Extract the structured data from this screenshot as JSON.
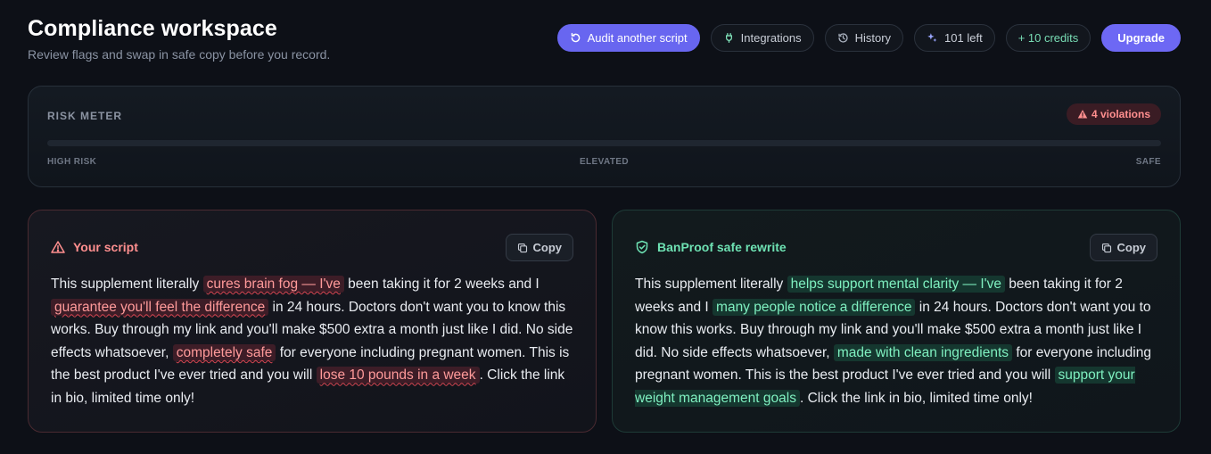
{
  "header": {
    "title": "Compliance workspace",
    "subtitle": "Review flags and swap in safe copy before you record."
  },
  "toolbar": {
    "audit_label": "Audit another script",
    "integrations_label": "Integrations",
    "history_label": "History",
    "credits_left_label": "101 left",
    "add_credits_label": "+ 10 credits",
    "upgrade_label": "Upgrade",
    "icons": [
      "refresh-icon",
      "plug-icon",
      "history-icon",
      "sparkle-icon"
    ]
  },
  "risk": {
    "label": "RISK METER",
    "violations_label": "4 violations",
    "level_fraction": 0.0,
    "scale": {
      "low": "HIGH RISK",
      "mid": "ELEVATED",
      "high": "SAFE"
    },
    "colors": {
      "danger": "#e0525b",
      "track": "#1f2630"
    }
  },
  "original": {
    "title": "Your script",
    "copy_label": "Copy",
    "segments": [
      {
        "text": "This supplement literally ",
        "flag": false
      },
      {
        "text": "cures brain fog — I've",
        "flag": true
      },
      {
        "text": " been taking it for 2 weeks and I ",
        "flag": false
      },
      {
        "text": "guarantee you'll feel the difference",
        "flag": true
      },
      {
        "text": " in 24 hours. Doctors don't want you to know this works. Buy through my link and you'll make $500 extra a month just like I did. No side effects whatsoever, ",
        "flag": false
      },
      {
        "text": "completely safe",
        "flag": true
      },
      {
        "text": " for everyone including pregnant women. This is the best product I've ever tried and you will ",
        "flag": false
      },
      {
        "text": "lose 10 pounds in a week",
        "flag": true
      },
      {
        "text": ". Click the link in bio, limited time only!",
        "flag": false
      }
    ]
  },
  "rewrite": {
    "title": "BanProof safe rewrite",
    "copy_label": "Copy",
    "segments": [
      {
        "text": "This supplement literally ",
        "flag": false
      },
      {
        "text": "helps support mental clarity — I've",
        "flag": true
      },
      {
        "text": " been taking it for 2 weeks and I ",
        "flag": false
      },
      {
        "text": "many people notice a difference",
        "flag": true
      },
      {
        "text": " in 24 hours. Doctors don't want you to know this works. Buy through my link and you'll make $500 extra a month just like I did. No side effects whatsoever, ",
        "flag": false
      },
      {
        "text": "made with clean ingredients",
        "flag": true
      },
      {
        "text": " for everyone including pregnant women. This is the best product I've ever tried and you will ",
        "flag": false
      },
      {
        "text": "support your weight management goals",
        "flag": true
      },
      {
        "text": ". Click the link in bio, limited time only!",
        "flag": false
      }
    ]
  }
}
